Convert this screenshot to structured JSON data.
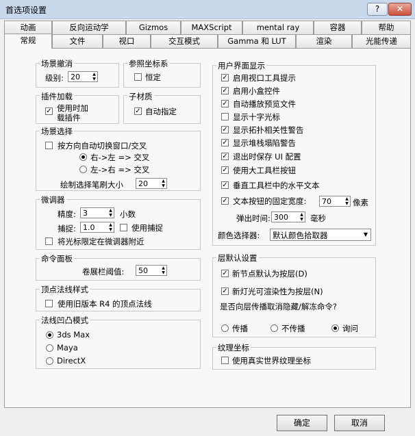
{
  "window": {
    "title": "首选项设置",
    "help_label": "?",
    "close_label": "✕"
  },
  "tabs_row1": [
    "动画",
    "反向运动学",
    "Gizmos",
    "MAXScript",
    "mental ray",
    "容器",
    "帮助"
  ],
  "tabs_row2": [
    "常规",
    "文件",
    "视口",
    "交互模式",
    "Gamma 和 LUT",
    "渲染",
    "光能传递"
  ],
  "scene_undo": {
    "title": "场景撤消",
    "level_label": "级别:",
    "level_value": "20"
  },
  "ref_coord": {
    "title": "参照坐标系",
    "constant_label": "恒定",
    "constant_checked": false
  },
  "plugin_load": {
    "title": "插件加载",
    "line1": "使用时加",
    "line2": "载插件",
    "checked": true
  },
  "sub_material": {
    "title": "子材质",
    "auto_assign_label": "自动指定",
    "checked": true
  },
  "scene_selection": {
    "title": "场景选择",
    "auto_switch_label": "按方向自动切换窗口/交叉",
    "auto_switch_checked": false,
    "right_to_left": "右->左 => 交叉",
    "left_to_right": "左->右 => 交叉",
    "selected_option": "right_to_left",
    "brush_size_label": "绘制选择笔刷大小",
    "brush_size_value": "20"
  },
  "spinners": {
    "title": "微调器",
    "precision_label": "精度:",
    "precision_value": "3",
    "decimals_label": "小数",
    "snap_label": "捕捉:",
    "snap_value": "1.0",
    "use_snap_label": "使用捕捉",
    "use_snap_checked": false,
    "cursor_wrap_label": "将光标限定在微调器附近",
    "cursor_wrap_checked": false
  },
  "command_panel": {
    "title": "命令面板",
    "threshold_label": "卷展栏阈值:",
    "threshold_value": "50"
  },
  "vertex_normal": {
    "title": "顶点法线样式",
    "legacy_label": "使用旧版本 R4 的顶点法线",
    "checked": false
  },
  "normal_bump": {
    "title": "法线凹凸模式",
    "options": [
      "3ds Max",
      "Maya",
      "DirectX"
    ],
    "selected_index": 0
  },
  "ui_display": {
    "title": "用户界面显示",
    "items": [
      {
        "label": "启用视口工具提示",
        "checked": true
      },
      {
        "label": "启用小盒控件",
        "checked": true
      },
      {
        "label": "自动播放预览文件",
        "checked": true
      },
      {
        "label": "显示十字光标",
        "checked": false
      },
      {
        "label": "显示拓扑相关性警告",
        "checked": true
      },
      {
        "label": "显示堆栈塌陷警告",
        "checked": true
      },
      {
        "label": "退出时保存 UI 配置",
        "checked": true
      },
      {
        "label": "使用大工具栏按钮",
        "checked": true
      },
      {
        "label": "垂直工具栏中的水平文本",
        "checked": true
      },
      {
        "label": "文本按钮的固定宽度:",
        "checked": true
      }
    ],
    "fixed_width_value": "70",
    "fixed_width_unit": "像素",
    "flyout_label": "弹出时间:",
    "flyout_value": "300",
    "flyout_unit": "毫秒",
    "color_picker_label": "颜色选择器:",
    "color_picker_value": "默认颜色拾取器"
  },
  "layer_defaults": {
    "title": "层默认设置",
    "new_nodes_label": "新节点默认为按层(D)",
    "new_nodes_checked": true,
    "new_lights_label": "新灯光可渲染性为按层(N)",
    "new_lights_checked": true,
    "question": "是否向层传播取消隐藏/解冻命令?",
    "options": [
      "传播",
      "不传播",
      "询问"
    ],
    "selected_index": 2
  },
  "texture_coords": {
    "title": "纹理坐标",
    "real_world_label": "使用真实世界纹理坐标",
    "checked": false
  },
  "footer": {
    "ok_label": "确定",
    "cancel_label": "取消"
  },
  "symbols": {
    "check": "✓",
    "up": "▲",
    "down": "▼",
    "dropdown": "▼"
  }
}
